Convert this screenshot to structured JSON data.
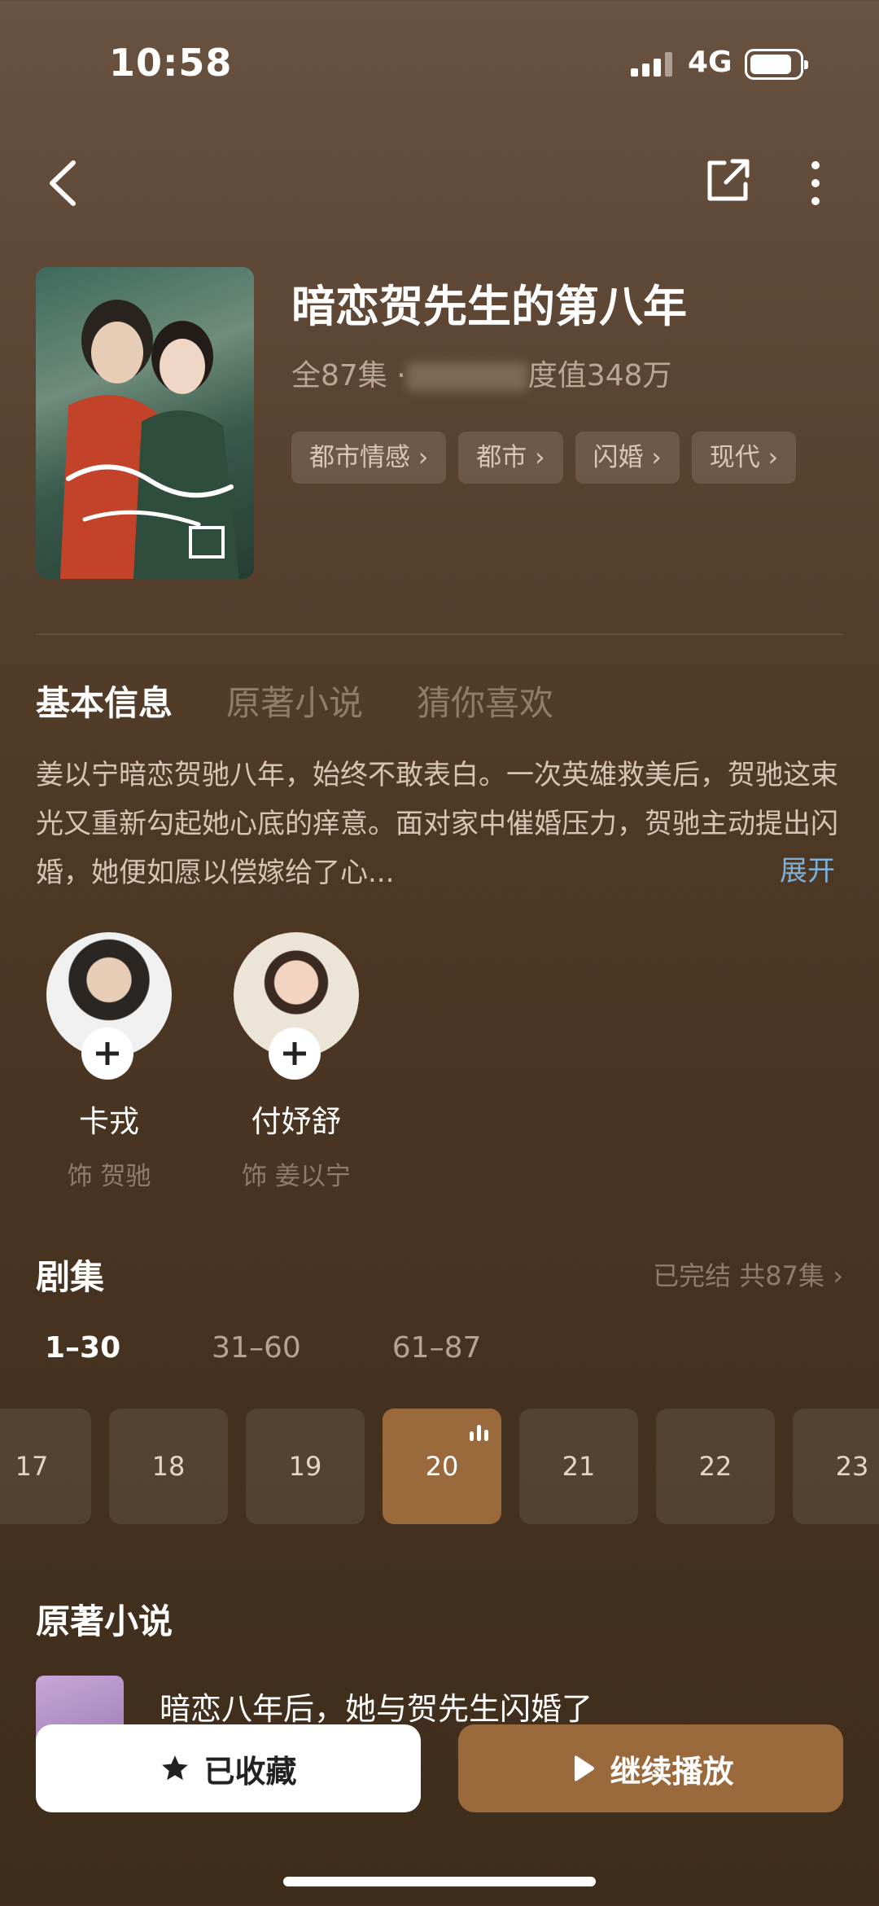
{
  "status": {
    "time": "10:58",
    "network": "4G"
  },
  "header": {
    "title": "暗恋贺先生的第八年",
    "episodes": "全87集 ·",
    "heat": "度值348万",
    "tags": [
      "都市情感 ›",
      "都市 ›",
      "闪婚 ›",
      "现代 ›"
    ]
  },
  "tabs": [
    "基本信息",
    "原著小说",
    "猜你喜欢"
  ],
  "description": {
    "text": "姜以宁暗恋贺驰八年，始终不敢表白。一次英雄救美后，贺驰这束光又重新勾起她心底的痒意。面对家中催婚压力，贺驰主动提出闪婚，她便如愿以偿嫁给了心...",
    "expand": "展开"
  },
  "cast": [
    {
      "name": "卡戎",
      "role": "饰 贺驰"
    },
    {
      "name": "付妤舒",
      "role": "饰 姜以宁"
    }
  ],
  "episodes_section": {
    "title": "剧集",
    "status": "已完结 共87集 ›",
    "ranges": [
      "1–30",
      "31–60",
      "61–87"
    ],
    "items": [
      "17",
      "18",
      "19",
      "20",
      "21",
      "22",
      "23"
    ],
    "current": "20"
  },
  "novel": {
    "title": "原著小说",
    "book_title": "暗恋八年后，她与贺先生闪婚了"
  },
  "actions": {
    "favorite": "已收藏",
    "play": "继续播放"
  },
  "colors": {
    "accent": "#9a6a3c",
    "link": "#7eb0dc"
  }
}
